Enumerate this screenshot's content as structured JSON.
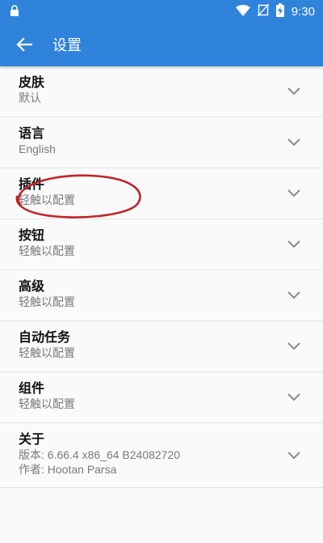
{
  "status": {
    "time": "9:30"
  },
  "appbar": {
    "title": "设置"
  },
  "items": [
    {
      "title": "皮肤",
      "sub": "默认"
    },
    {
      "title": "语言",
      "sub": "English"
    },
    {
      "title": "插件",
      "sub": "轻触以配置"
    },
    {
      "title": "按钮",
      "sub": "轻触以配置"
    },
    {
      "title": "高级",
      "sub": "轻触以配置"
    },
    {
      "title": "自动任务",
      "sub": "轻触以配置"
    },
    {
      "title": "组件",
      "sub": "轻触以配置"
    },
    {
      "title": "关于",
      "sub": "版本: 6.66.4 x86_64  B24082720",
      "sub2": "作者: Hootan Parsa"
    }
  ],
  "icons": [
    "lock-icon",
    "wifi-icon",
    "no-sim-icon",
    "battery-charging-icon",
    "back-arrow-icon",
    "chevron-down-icon"
  ],
  "colors": {
    "appbar": "#2f83db",
    "annotation": "#c0232b"
  }
}
